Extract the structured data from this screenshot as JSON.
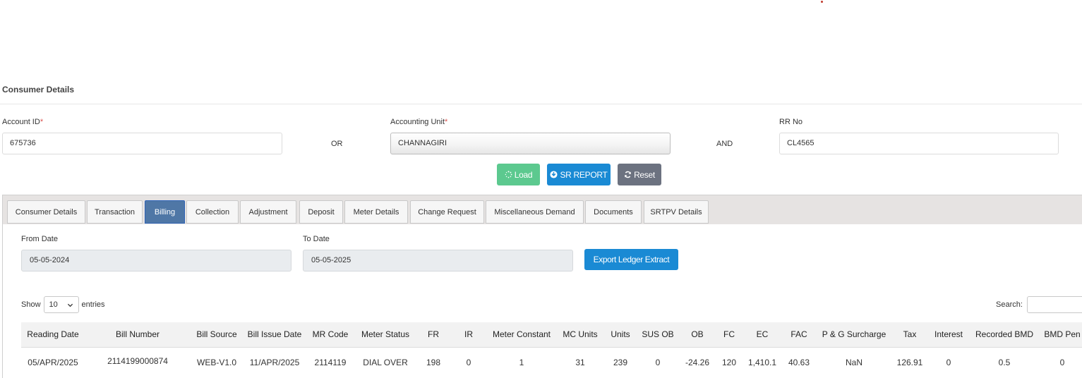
{
  "section_title": "Consumer Details",
  "form": {
    "account_id_label": "Account ID",
    "account_id_value": "675736",
    "or_text": "OR",
    "accounting_unit_label": "Accounting Unit",
    "accounting_unit_value": "CHANNAGIRI",
    "and_text": "AND",
    "rr_no_label": "RR No",
    "rr_no_value": "CL4565",
    "required_mark": "*"
  },
  "buttons": {
    "load": "Load",
    "sr_report": "SR REPORT",
    "reset": "Reset"
  },
  "tabs": [
    {
      "label": "Consumer Details",
      "active": false
    },
    {
      "label": "Transaction",
      "active": false
    },
    {
      "label": "Billing",
      "active": true
    },
    {
      "label": "Collection",
      "active": false
    },
    {
      "label": "Adjustment",
      "active": false
    },
    {
      "label": "Deposit",
      "active": false
    },
    {
      "label": "Meter Details",
      "active": false
    },
    {
      "label": "Change Request",
      "active": false
    },
    {
      "label": "Miscellaneous Demand",
      "active": false
    },
    {
      "label": "Documents",
      "active": false
    },
    {
      "label": "SRTPV Details",
      "active": false
    }
  ],
  "billing": {
    "from_date_label": "From Date",
    "from_date_value": "05-05-2024",
    "to_date_label": "To Date",
    "to_date_value": "05-05-2025",
    "export_label": "Export Ledger Extract"
  },
  "table_controls": {
    "show_label": "Show",
    "entries_value": "10",
    "entries_label": "entries",
    "search_label": "Search:"
  },
  "table": {
    "columns": [
      "Reading Date",
      "Bill Number",
      "Bill Source",
      "Bill Issue Date",
      "MR Code",
      "Meter Status",
      "FR",
      "IR",
      "Meter Constant",
      "MC Units",
      "Units",
      "SUS OB",
      "OB",
      "FC",
      "EC",
      "FAC",
      "P & G Surcharge",
      "Tax",
      "Interest",
      "Recorded BMD",
      "BMD Pen"
    ],
    "rows": [
      [
        "05/APR/2025",
        "2114199000874",
        "WEB-V1.0",
        "11/APR/2025",
        "2114119",
        "DIAL OVER",
        "198",
        "0",
        "1",
        "31",
        "239",
        "0",
        "-24.26",
        "120",
        "1,410.1",
        "40.63",
        "NaN",
        "126.91",
        "0",
        "0.5",
        "0"
      ]
    ]
  },
  "colors": {
    "tab_active": "#4f77a6",
    "primary": "#1a8ad4",
    "success": "#5cc98f",
    "secondary": "#6c7280"
  }
}
